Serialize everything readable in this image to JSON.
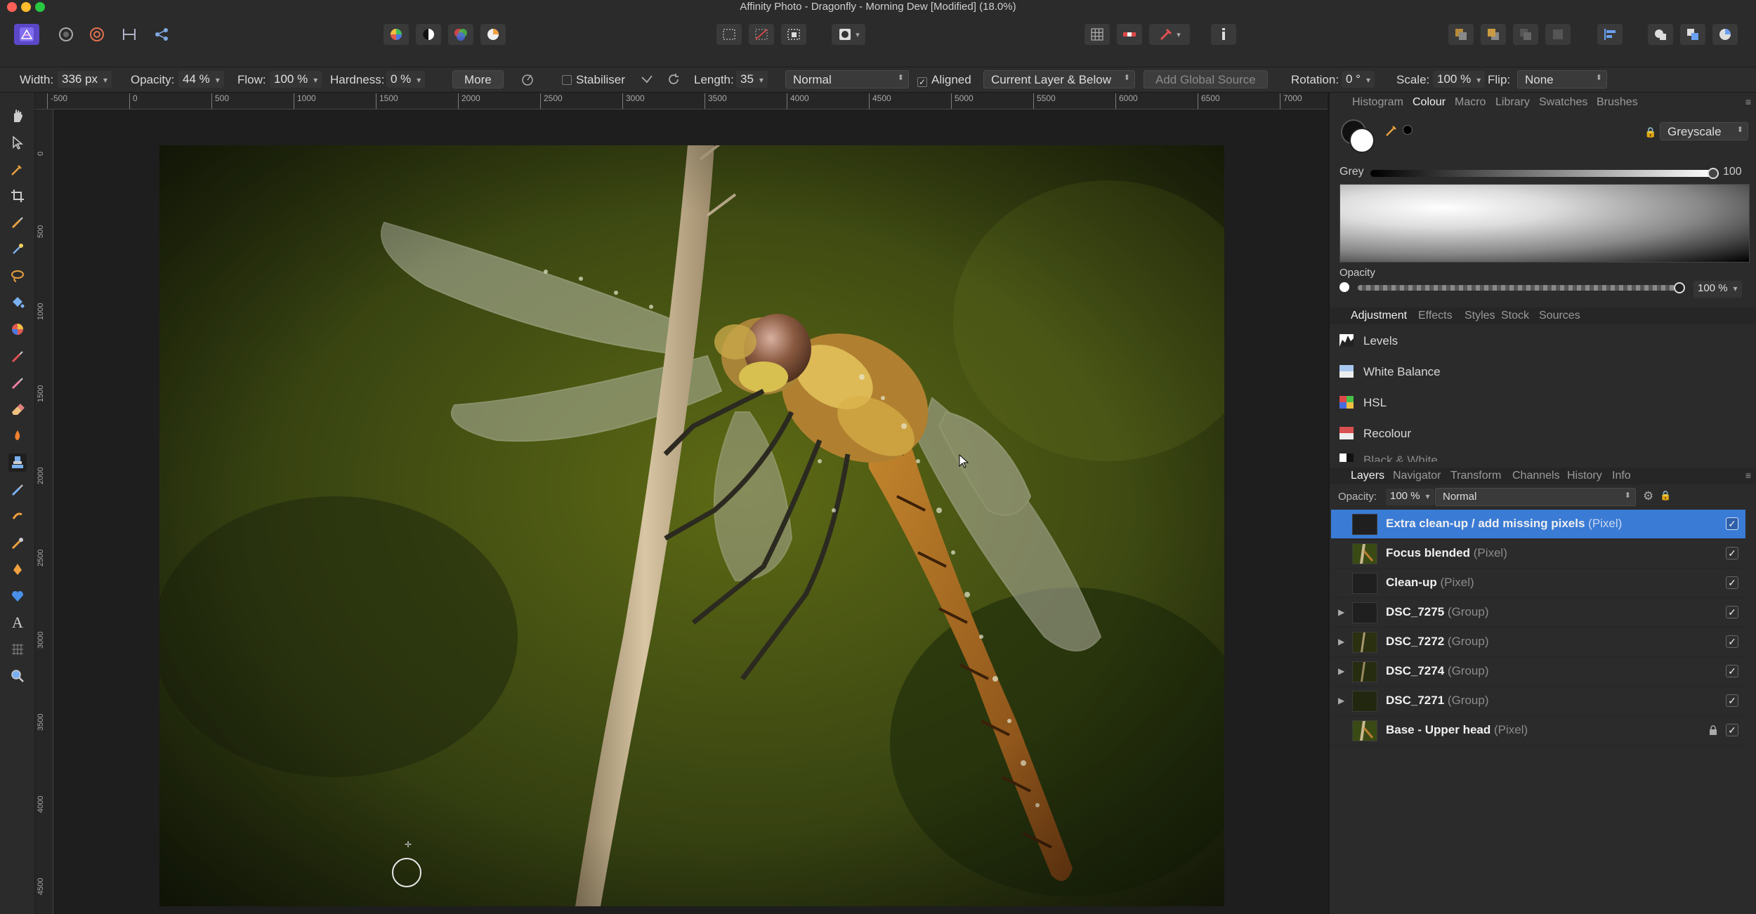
{
  "window": {
    "title": "Affinity Photo - Dragonfly - Morning Dew [Modified] (18.0%)",
    "traffic_colors": [
      "#fe5f57",
      "#febc2e",
      "#28c840"
    ]
  },
  "toolbar": {
    "icons": [
      "affinity-logo-icon",
      "photo-persona-icon",
      "liquify-persona-icon",
      "develop-persona-icon",
      "export-persona-icon",
      "colour-wheel-icon",
      "contrast-icon",
      "colour-balance-icon",
      "white-balance-icon",
      "marquee-select-icon",
      "deselect-icon",
      "invert-selection-icon",
      "quick-mask-icon",
      "grid-icon",
      "snapping-icon",
      "assistant-icon",
      "alignment-icon"
    ]
  },
  "context_bar": {
    "width_label": "Width:",
    "width_value": "336 px",
    "opacity_label": "Opacity:",
    "opacity_value": "44 %",
    "flow_label": "Flow:",
    "flow_value": "100 %",
    "hardness_label": "Hardness:",
    "hardness_value": "0 %",
    "more_label": "More",
    "stabiliser_label": "Stabiliser",
    "length_label": "Length:",
    "length_value": "35",
    "blend_mode": "Normal",
    "aligned_label": "Aligned",
    "source_mode": "Current Layer & Below",
    "add_global_source": "Add Global Source",
    "rotation_label": "Rotation:",
    "rotation_value": "0 °",
    "scale_label": "Scale:",
    "scale_value": "100 %",
    "flip_label": "Flip:",
    "flip_value": "None"
  },
  "rulers": {
    "unit": "px",
    "horizontal": [
      "-500",
      "0",
      "500",
      "1000",
      "1500",
      "2000",
      "2500",
      "3000",
      "3500",
      "4000",
      "4500",
      "5000",
      "5500",
      "6000",
      "6500",
      "7000"
    ],
    "vertical": [
      "0",
      "500",
      "1000",
      "1500",
      "2000",
      "2500",
      "3000",
      "3500",
      "4000",
      "4500"
    ]
  },
  "colour_panel": {
    "tabs": [
      "Histogram",
      "Colour",
      "Macro",
      "Library",
      "Swatches",
      "Brushes"
    ],
    "active_tab": "Colour",
    "mode": "Greyscale",
    "grey_label": "Grey",
    "grey_value": "100",
    "opacity_label": "Opacity",
    "opacity_value": "100 %"
  },
  "adjustment_panel": {
    "tabs": [
      "Adjustment",
      "Effects",
      "Styles",
      "Stock",
      "Sources"
    ],
    "active_tab": "Adjustment",
    "items": [
      {
        "label": "Levels",
        "icon": "levels-icon"
      },
      {
        "label": "White Balance",
        "icon": "white-balance-icon"
      },
      {
        "label": "HSL",
        "icon": "hsl-icon"
      },
      {
        "label": "Recolour",
        "icon": "recolour-icon"
      },
      {
        "label": "Black & White",
        "icon": "black-white-icon"
      }
    ]
  },
  "layers_panel": {
    "tabs": [
      "Layers",
      "Navigator",
      "Transform",
      "Channels",
      "History",
      "Info"
    ],
    "active_tab": "Layers",
    "opacity_label": "Opacity:",
    "opacity_value": "100 %",
    "blend_mode": "Normal",
    "layers": [
      {
        "name": "Extra clean-up / add missing pixels",
        "type": "(Pixel)",
        "selected": true,
        "group": false,
        "locked": false
      },
      {
        "name": "Focus blended",
        "type": "(Pixel)",
        "selected": false,
        "group": false,
        "locked": false
      },
      {
        "name": "Clean-up",
        "type": "(Pixel)",
        "selected": false,
        "group": false,
        "locked": false
      },
      {
        "name": "DSC_7275",
        "type": "(Group)",
        "selected": false,
        "group": true,
        "locked": false
      },
      {
        "name": "DSC_7272",
        "type": "(Group)",
        "selected": false,
        "group": true,
        "locked": false
      },
      {
        "name": "DSC_7274",
        "type": "(Group)",
        "selected": false,
        "group": true,
        "locked": false
      },
      {
        "name": "DSC_7271",
        "type": "(Group)",
        "selected": false,
        "group": true,
        "locked": false
      },
      {
        "name": "Base - Upper head",
        "type": "(Pixel)",
        "selected": false,
        "group": false,
        "locked": true
      }
    ],
    "check_mark": "✓"
  },
  "colors": {
    "accent": "#3a7bd5",
    "panel_bg": "#2b2b2b",
    "canvas_bg": "#1e1e1e"
  }
}
